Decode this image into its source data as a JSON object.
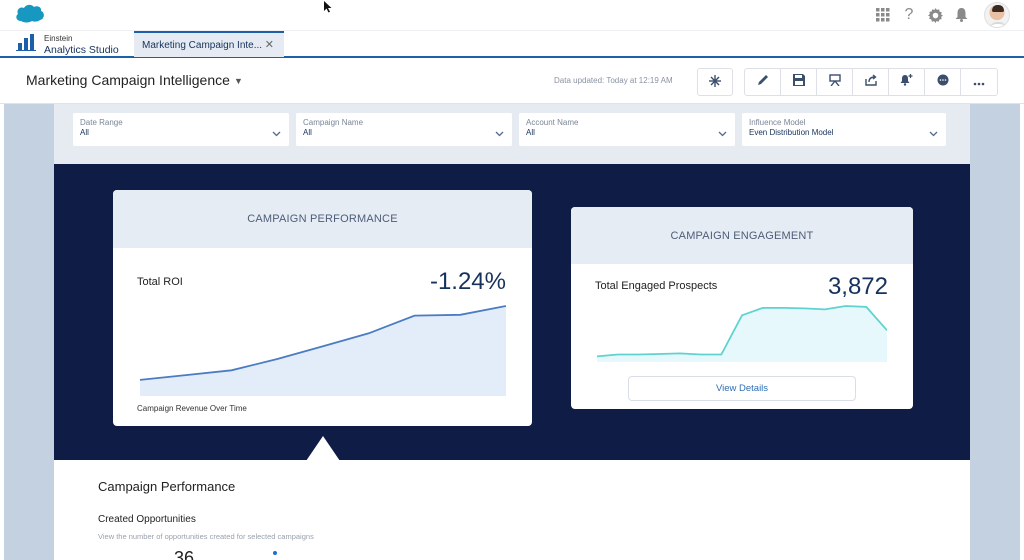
{
  "app": {
    "brand_icon": "salesforce-cloud-icon",
    "name_line1": "Einstein",
    "name_line2": "Analytics Studio",
    "top_icons": [
      "app-launcher-icon",
      "help-icon",
      "setup-gear-icon",
      "notifications-bell-icon",
      "user-avatar"
    ]
  },
  "tabs": [
    {
      "label": "Marketing Campaign Inte...",
      "active": true,
      "closable": true
    }
  ],
  "header": {
    "title": "Marketing Campaign Intelligence",
    "data_updated": "Data updated: Today at 12:19 AM",
    "actions": [
      "spark-icon",
      "edit-icon",
      "save-icon",
      "present-icon",
      "share-icon",
      "notify-icon",
      "comment-icon",
      "more-icon"
    ]
  },
  "filters": [
    {
      "label": "Date Range",
      "value": "All"
    },
    {
      "label": "Campaign Name",
      "value": "All"
    },
    {
      "label": "Account Name",
      "value": "All"
    },
    {
      "label": "Influence Model",
      "value": "Even Distribution Model"
    }
  ],
  "cards": {
    "performance": {
      "title": "CAMPAIGN PERFORMANCE",
      "metric_label": "Total ROI",
      "metric_value": "-1.24%",
      "chart_caption": "Campaign Revenue Over Time",
      "line_color": "#4a7cc3",
      "fill_color": "#e3edfa",
      "series": [
        10,
        13,
        16,
        23,
        31,
        39,
        50,
        50.5,
        56
      ]
    },
    "engagement": {
      "title": "CAMPAIGN ENGAGEMENT",
      "metric_label": "Total Engaged Prospects",
      "metric_value": "3,872",
      "button_label": "View Details",
      "line_color": "#5fd3cf",
      "fill_color": "#e6f8fb",
      "series": [
        3,
        4,
        4,
        4.3,
        4.6,
        4,
        4,
        25,
        29,
        29,
        28.7,
        28.2,
        30,
        29.5,
        17
      ]
    }
  },
  "section": {
    "title": "Campaign Performance",
    "subtitle": "Created Opportunities",
    "description": "View the number of opportunities created for selected campaigns",
    "partial_value": "36"
  }
}
